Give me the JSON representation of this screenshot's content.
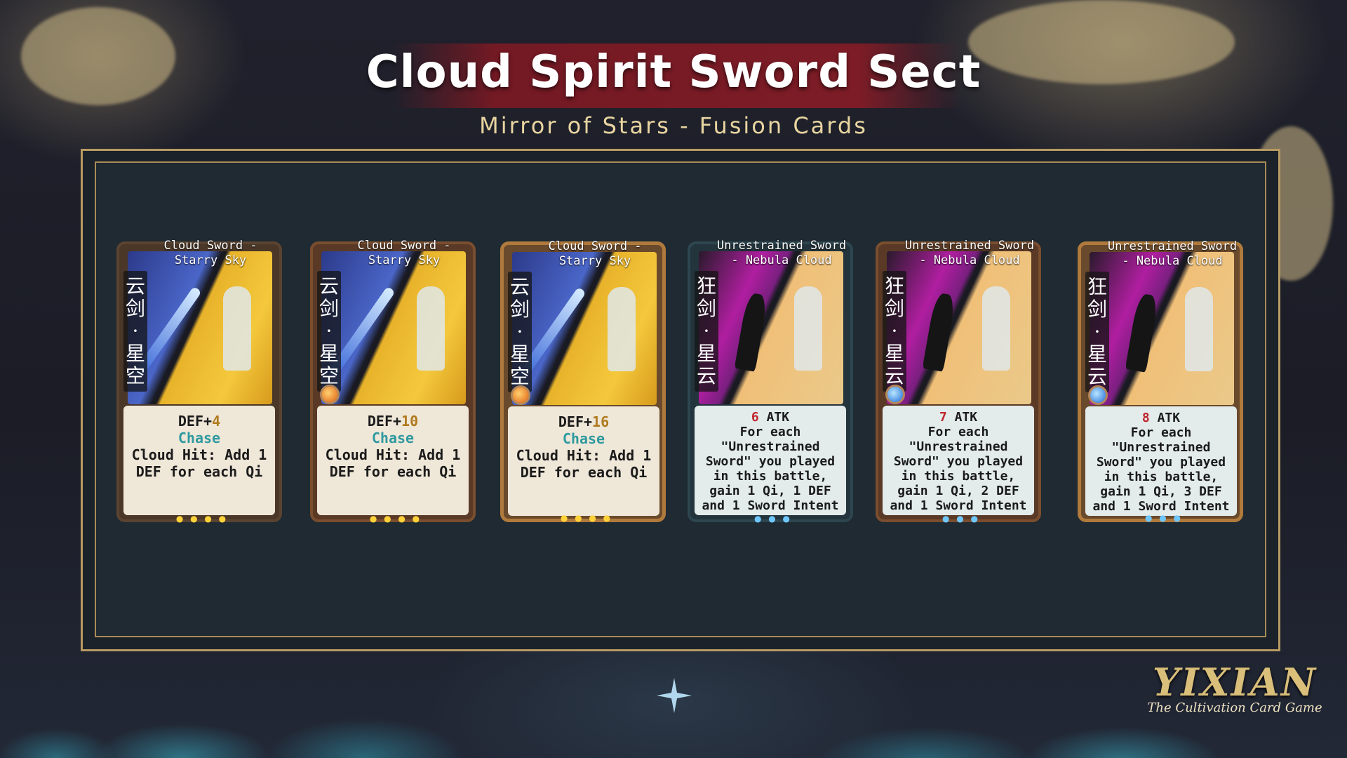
{
  "header": {
    "title": "Cloud Spirit Sword Sect",
    "subtitle": "Mirror of Stars - Fusion Cards"
  },
  "cards": [
    {
      "name": "Cloud Sword - Starry Sky",
      "cn_label": "云剑·星空",
      "line1_prefix": "DEF+",
      "line1_value": "4",
      "keyword": "Chase",
      "body": "Cloud Hit: Add 1 DEF for each Qi",
      "art": "sky",
      "frame": "gold",
      "gem": "none"
    },
    {
      "name": "Cloud Sword - Starry Sky",
      "cn_label": "云剑·星空",
      "line1_prefix": "DEF+",
      "line1_value": "10",
      "keyword": "Chase",
      "body": "Cloud Hit: Add 1 DEF for each Qi",
      "art": "sky",
      "frame": "bronze",
      "gem": "orange"
    },
    {
      "name": "Cloud Sword - Starry Sky",
      "cn_label": "云剑·星空",
      "line1_prefix": "DEF+",
      "line1_value": "16",
      "keyword": "Chase",
      "body": "Cloud Hit: Add 1 DEF for each Qi",
      "art": "sky",
      "frame": "ornate",
      "gem": "orange"
    },
    {
      "name": "Unrestrained Sword - Nebula Cloud",
      "cn_label": "狂剑·星云",
      "atk_value": "6",
      "atk_suffix": " ATK",
      "body": "For each \"Unrestrained Sword\" you played in this battle, gain 1 Qi, 1 DEF and 1 Sword Intent",
      "art": "nebula",
      "frame": "teal",
      "gem": "none"
    },
    {
      "name": "Unrestrained Sword - Nebula Cloud",
      "cn_label": "狂剑·星云",
      "atk_value": "7",
      "atk_suffix": " ATK",
      "body": "For each \"Unrestrained Sword\" you played in this battle, gain 1 Qi, 2 DEF and 1 Sword Intent",
      "art": "nebula",
      "frame": "bronze",
      "gem": "blue"
    },
    {
      "name": "Unrestrained Sword - Nebula Cloud",
      "cn_label": "狂剑·星云",
      "atk_value": "8",
      "atk_suffix": " ATK",
      "body": "For each \"Unrestrained Sword\" you played in this battle, gain 1 Qi, 3 DEF and 1 Sword Intent",
      "art": "nebula",
      "frame": "ornate",
      "gem": "blue"
    }
  ],
  "logo": {
    "main": "YIXIAN",
    "sub": "The Cultivation Card Game"
  }
}
